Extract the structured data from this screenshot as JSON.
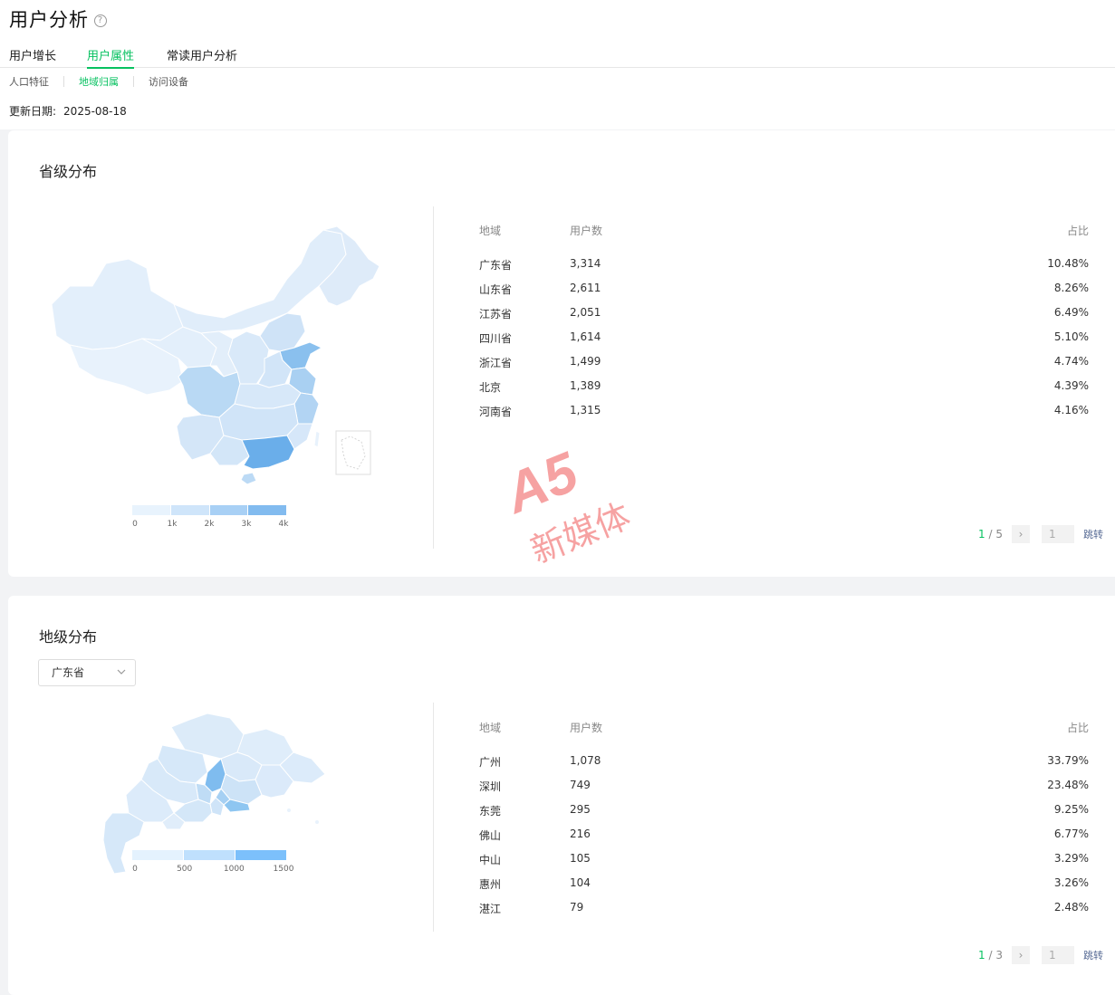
{
  "header": {
    "title": "用户分析",
    "help_icon": "?",
    "tabs": [
      {
        "label": "用户增长",
        "active": false
      },
      {
        "label": "用户属性",
        "active": true
      },
      {
        "label": "常读用户分析",
        "active": false
      }
    ],
    "subtabs": [
      {
        "label": "人口特征",
        "active": false
      },
      {
        "label": "地域归属",
        "active": true
      },
      {
        "label": "访问设备",
        "active": false
      }
    ],
    "update_label": "更新日期:",
    "update_date": "2025-08-18"
  },
  "province": {
    "title": "省级分布",
    "columns": {
      "region": "地域",
      "count": "用户数",
      "ratio": "占比"
    },
    "rows": [
      {
        "region": "广东省",
        "count": "3,314",
        "ratio": "10.48%"
      },
      {
        "region": "山东省",
        "count": "2,611",
        "ratio": "8.26%"
      },
      {
        "region": "江苏省",
        "count": "2,051",
        "ratio": "6.49%"
      },
      {
        "region": "四川省",
        "count": "1,614",
        "ratio": "5.10%"
      },
      {
        "region": "浙江省",
        "count": "1,499",
        "ratio": "4.74%"
      },
      {
        "region": "北京",
        "count": "1,389",
        "ratio": "4.39%"
      },
      {
        "region": "河南省",
        "count": "1,315",
        "ratio": "4.16%"
      }
    ],
    "legend_ticks": [
      "0",
      "1k",
      "2k",
      "3k",
      "4k"
    ],
    "legend_colors": [
      "#e8f3fd",
      "#cfe5fa",
      "#a8d0f5",
      "#82bbef"
    ],
    "pager": {
      "current": "1",
      "sep": " / ",
      "total": "5",
      "next": "›",
      "input": "1",
      "jump": "跳转"
    }
  },
  "city": {
    "title": "地级分布",
    "dropdown_value": "广东省",
    "dropdown_icon": "chevron-down-icon",
    "columns": {
      "region": "地域",
      "count": "用户数",
      "ratio": "占比"
    },
    "rows": [
      {
        "region": "广州",
        "count": "1,078",
        "ratio": "33.79%"
      },
      {
        "region": "深圳",
        "count": "749",
        "ratio": "23.48%"
      },
      {
        "region": "东莞",
        "count": "295",
        "ratio": "9.25%"
      },
      {
        "region": "佛山",
        "count": "216",
        "ratio": "6.77%"
      },
      {
        "region": "中山",
        "count": "105",
        "ratio": "3.29%"
      },
      {
        "region": "惠州",
        "count": "104",
        "ratio": "3.26%"
      },
      {
        "region": "湛江",
        "count": "79",
        "ratio": "2.48%"
      }
    ],
    "legend_ticks": [
      "0",
      "500",
      "1000",
      "1500"
    ],
    "legend_colors": [
      "#e4f2fe",
      "#bfe0fd",
      "#7cc0fb"
    ],
    "pager": {
      "current": "1",
      "sep": " / ",
      "total": "3",
      "next": "›",
      "input": "1",
      "jump": "跳转"
    }
  },
  "watermark": {
    "logo": "A5",
    "text": "新媒体"
  }
}
